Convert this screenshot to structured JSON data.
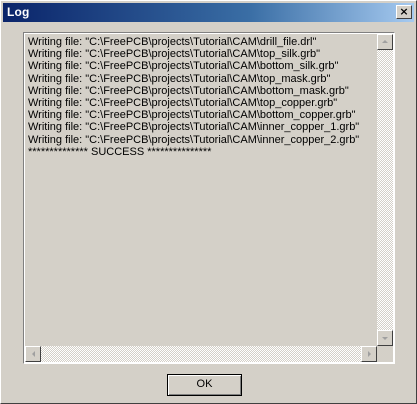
{
  "window": {
    "title": "Log",
    "close_glyph": "×"
  },
  "log": {
    "lines": [
      "Writing file: \"C:\\FreePCB\\projects\\Tutorial\\CAM\\drill_file.drl\"",
      "Writing file: \"C:\\FreePCB\\projects\\Tutorial\\CAM\\top_silk.grb\"",
      "Writing file: \"C:\\FreePCB\\projects\\Tutorial\\CAM\\bottom_silk.grb\"",
      "Writing file: \"C:\\FreePCB\\projects\\Tutorial\\CAM\\top_mask.grb\"",
      "Writing file: \"C:\\FreePCB\\projects\\Tutorial\\CAM\\bottom_mask.grb\"",
      "Writing file: \"C:\\FreePCB\\projects\\Tutorial\\CAM\\top_copper.grb\"",
      "Writing file: \"C:\\FreePCB\\projects\\Tutorial\\CAM\\bottom_copper.grb\"",
      "Writing file: \"C:\\FreePCB\\projects\\Tutorial\\CAM\\inner_copper_1.grb\"",
      "Writing file: \"C:\\FreePCB\\projects\\Tutorial\\CAM\\inner_copper_2.grb\"",
      "************** SUCCESS ***************"
    ]
  },
  "buttons": {
    "ok_label": "OK"
  },
  "icons": {
    "close": "close-icon",
    "scroll_up": "scroll-up-arrow-icon",
    "scroll_down": "scroll-down-arrow-icon",
    "scroll_left": "scroll-left-arrow-icon",
    "scroll_right": "scroll-right-arrow-icon"
  },
  "colors": {
    "title_gradient_start": "#0a246a",
    "title_gradient_end": "#a6caf0",
    "dialog_face": "#d4d0c8"
  }
}
